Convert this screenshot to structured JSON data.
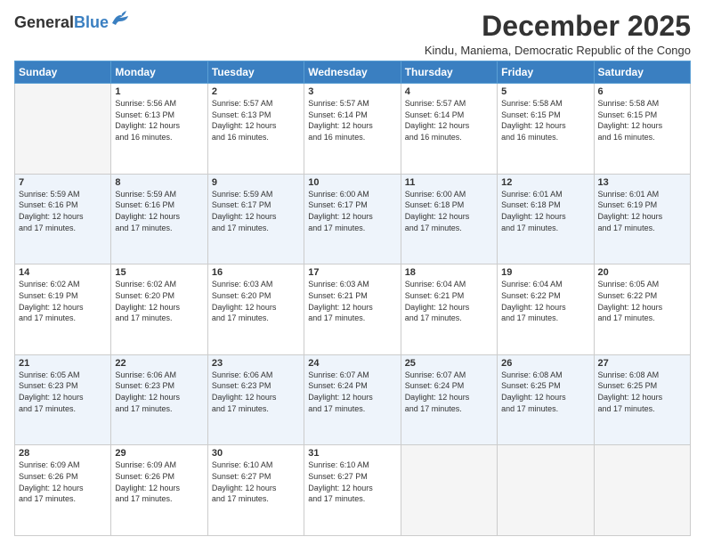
{
  "header": {
    "logo_general": "General",
    "logo_blue": "Blue",
    "month_title": "December 2025",
    "location": "Kindu, Maniema, Democratic Republic of the Congo"
  },
  "days_of_week": [
    "Sunday",
    "Monday",
    "Tuesday",
    "Wednesday",
    "Thursday",
    "Friday",
    "Saturday"
  ],
  "weeks": [
    [
      {
        "day": "",
        "sunrise": "",
        "sunset": "",
        "daylight": "",
        "empty": true
      },
      {
        "day": "1",
        "sunrise": "Sunrise: 5:56 AM",
        "sunset": "Sunset: 6:13 PM",
        "daylight": "Daylight: 12 hours and 16 minutes."
      },
      {
        "day": "2",
        "sunrise": "Sunrise: 5:57 AM",
        "sunset": "Sunset: 6:13 PM",
        "daylight": "Daylight: 12 hours and 16 minutes."
      },
      {
        "day": "3",
        "sunrise": "Sunrise: 5:57 AM",
        "sunset": "Sunset: 6:14 PM",
        "daylight": "Daylight: 12 hours and 16 minutes."
      },
      {
        "day": "4",
        "sunrise": "Sunrise: 5:57 AM",
        "sunset": "Sunset: 6:14 PM",
        "daylight": "Daylight: 12 hours and 16 minutes."
      },
      {
        "day": "5",
        "sunrise": "Sunrise: 5:58 AM",
        "sunset": "Sunset: 6:15 PM",
        "daylight": "Daylight: 12 hours and 16 minutes."
      },
      {
        "day": "6",
        "sunrise": "Sunrise: 5:58 AM",
        "sunset": "Sunset: 6:15 PM",
        "daylight": "Daylight: 12 hours and 16 minutes."
      }
    ],
    [
      {
        "day": "7",
        "sunrise": "Sunrise: 5:59 AM",
        "sunset": "Sunset: 6:16 PM",
        "daylight": "Daylight: 12 hours and 17 minutes."
      },
      {
        "day": "8",
        "sunrise": "Sunrise: 5:59 AM",
        "sunset": "Sunset: 6:16 PM",
        "daylight": "Daylight: 12 hours and 17 minutes."
      },
      {
        "day": "9",
        "sunrise": "Sunrise: 5:59 AM",
        "sunset": "Sunset: 6:17 PM",
        "daylight": "Daylight: 12 hours and 17 minutes."
      },
      {
        "day": "10",
        "sunrise": "Sunrise: 6:00 AM",
        "sunset": "Sunset: 6:17 PM",
        "daylight": "Daylight: 12 hours and 17 minutes."
      },
      {
        "day": "11",
        "sunrise": "Sunrise: 6:00 AM",
        "sunset": "Sunset: 6:18 PM",
        "daylight": "Daylight: 12 hours and 17 minutes."
      },
      {
        "day": "12",
        "sunrise": "Sunrise: 6:01 AM",
        "sunset": "Sunset: 6:18 PM",
        "daylight": "Daylight: 12 hours and 17 minutes."
      },
      {
        "day": "13",
        "sunrise": "Sunrise: 6:01 AM",
        "sunset": "Sunset: 6:19 PM",
        "daylight": "Daylight: 12 hours and 17 minutes."
      }
    ],
    [
      {
        "day": "14",
        "sunrise": "Sunrise: 6:02 AM",
        "sunset": "Sunset: 6:19 PM",
        "daylight": "Daylight: 12 hours and 17 minutes."
      },
      {
        "day": "15",
        "sunrise": "Sunrise: 6:02 AM",
        "sunset": "Sunset: 6:20 PM",
        "daylight": "Daylight: 12 hours and 17 minutes."
      },
      {
        "day": "16",
        "sunrise": "Sunrise: 6:03 AM",
        "sunset": "Sunset: 6:20 PM",
        "daylight": "Daylight: 12 hours and 17 minutes."
      },
      {
        "day": "17",
        "sunrise": "Sunrise: 6:03 AM",
        "sunset": "Sunset: 6:21 PM",
        "daylight": "Daylight: 12 hours and 17 minutes."
      },
      {
        "day": "18",
        "sunrise": "Sunrise: 6:04 AM",
        "sunset": "Sunset: 6:21 PM",
        "daylight": "Daylight: 12 hours and 17 minutes."
      },
      {
        "day": "19",
        "sunrise": "Sunrise: 6:04 AM",
        "sunset": "Sunset: 6:22 PM",
        "daylight": "Daylight: 12 hours and 17 minutes."
      },
      {
        "day": "20",
        "sunrise": "Sunrise: 6:05 AM",
        "sunset": "Sunset: 6:22 PM",
        "daylight": "Daylight: 12 hours and 17 minutes."
      }
    ],
    [
      {
        "day": "21",
        "sunrise": "Sunrise: 6:05 AM",
        "sunset": "Sunset: 6:23 PM",
        "daylight": "Daylight: 12 hours and 17 minutes."
      },
      {
        "day": "22",
        "sunrise": "Sunrise: 6:06 AM",
        "sunset": "Sunset: 6:23 PM",
        "daylight": "Daylight: 12 hours and 17 minutes."
      },
      {
        "day": "23",
        "sunrise": "Sunrise: 6:06 AM",
        "sunset": "Sunset: 6:23 PM",
        "daylight": "Daylight: 12 hours and 17 minutes."
      },
      {
        "day": "24",
        "sunrise": "Sunrise: 6:07 AM",
        "sunset": "Sunset: 6:24 PM",
        "daylight": "Daylight: 12 hours and 17 minutes."
      },
      {
        "day": "25",
        "sunrise": "Sunrise: 6:07 AM",
        "sunset": "Sunset: 6:24 PM",
        "daylight": "Daylight: 12 hours and 17 minutes."
      },
      {
        "day": "26",
        "sunrise": "Sunrise: 6:08 AM",
        "sunset": "Sunset: 6:25 PM",
        "daylight": "Daylight: 12 hours and 17 minutes."
      },
      {
        "day": "27",
        "sunrise": "Sunrise: 6:08 AM",
        "sunset": "Sunset: 6:25 PM",
        "daylight": "Daylight: 12 hours and 17 minutes."
      }
    ],
    [
      {
        "day": "28",
        "sunrise": "Sunrise: 6:09 AM",
        "sunset": "Sunset: 6:26 PM",
        "daylight": "Daylight: 12 hours and 17 minutes."
      },
      {
        "day": "29",
        "sunrise": "Sunrise: 6:09 AM",
        "sunset": "Sunset: 6:26 PM",
        "daylight": "Daylight: 12 hours and 17 minutes."
      },
      {
        "day": "30",
        "sunrise": "Sunrise: 6:10 AM",
        "sunset": "Sunset: 6:27 PM",
        "daylight": "Daylight: 12 hours and 17 minutes."
      },
      {
        "day": "31",
        "sunrise": "Sunrise: 6:10 AM",
        "sunset": "Sunset: 6:27 PM",
        "daylight": "Daylight: 12 hours and 17 minutes."
      },
      {
        "day": "",
        "sunrise": "",
        "sunset": "",
        "daylight": "",
        "empty": true
      },
      {
        "day": "",
        "sunrise": "",
        "sunset": "",
        "daylight": "",
        "empty": true
      },
      {
        "day": "",
        "sunrise": "",
        "sunset": "",
        "daylight": "",
        "empty": true
      }
    ]
  ]
}
